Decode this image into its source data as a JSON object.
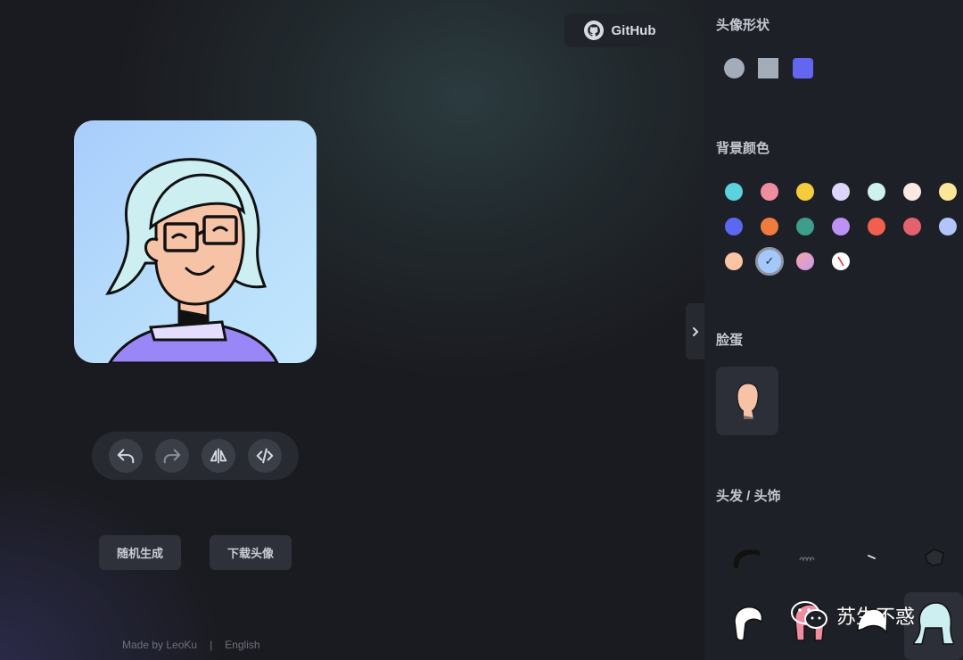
{
  "header": {
    "github_label": "GitHub"
  },
  "actions": {
    "undo": "undo-icon",
    "redo": "redo-icon",
    "flip": "flip-icon",
    "code": "code-icon"
  },
  "buttons": {
    "random": "随机生成",
    "download": "下载头像"
  },
  "footer": {
    "made_by": "Made by LeoKu",
    "separator": "|",
    "language": "English"
  },
  "panel": {
    "shape_title": "头像形状",
    "shapes": [
      {
        "name": "circle",
        "color": "#a3acb9"
      },
      {
        "name": "square",
        "color": "#a3acb9"
      },
      {
        "name": "squircle",
        "color": "#6366f1"
      }
    ],
    "bg_title": "背景颜色",
    "bg_colors": [
      "#5bd2df",
      "#f08ca0",
      "#f5cc3d",
      "#dcd6fb",
      "#cff1f0",
      "#fde9e4",
      "#fbe69a",
      "#5c67f2",
      "#f07b3f",
      "#3d9f8b",
      "#bd92f7",
      "#f25f4c",
      "#e4616f",
      "#b1c4fb",
      "#fbc5a5",
      "#a5c8fb",
      "#f3a0b5",
      "#ffffff"
    ],
    "bg_selected_index": 15,
    "bg_selected_mark": "✓",
    "face_title": "脸蛋",
    "hair_title": "头发 / 头饰"
  },
  "watermark": {
    "text": "苏生不惑"
  }
}
